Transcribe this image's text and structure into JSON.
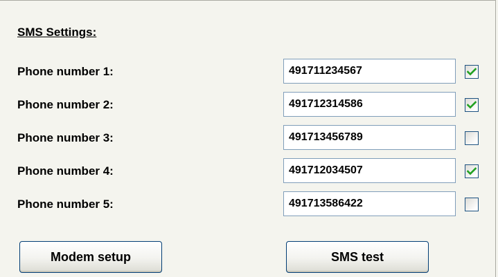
{
  "sms_settings": {
    "title": "SMS Settings:",
    "phones": [
      {
        "label": "Phone number 1:",
        "number": "491711234567",
        "enabled": true
      },
      {
        "label": "Phone number 2:",
        "number": "491712314586",
        "enabled": true
      },
      {
        "label": "Phone number 3:",
        "number": "491713456789",
        "enabled": false
      },
      {
        "label": "Phone number 4:",
        "number": "491712034507",
        "enabled": true
      },
      {
        "label": "Phone number 5:",
        "number": "491713586422",
        "enabled": false
      }
    ]
  },
  "buttons": {
    "modem_setup": "Modem setup",
    "sms_test": "SMS test"
  },
  "colors": {
    "background": "#f4f4ee",
    "checkmark": "#21a121",
    "input_border": "#7f9db9",
    "button_border": "#003c74"
  }
}
